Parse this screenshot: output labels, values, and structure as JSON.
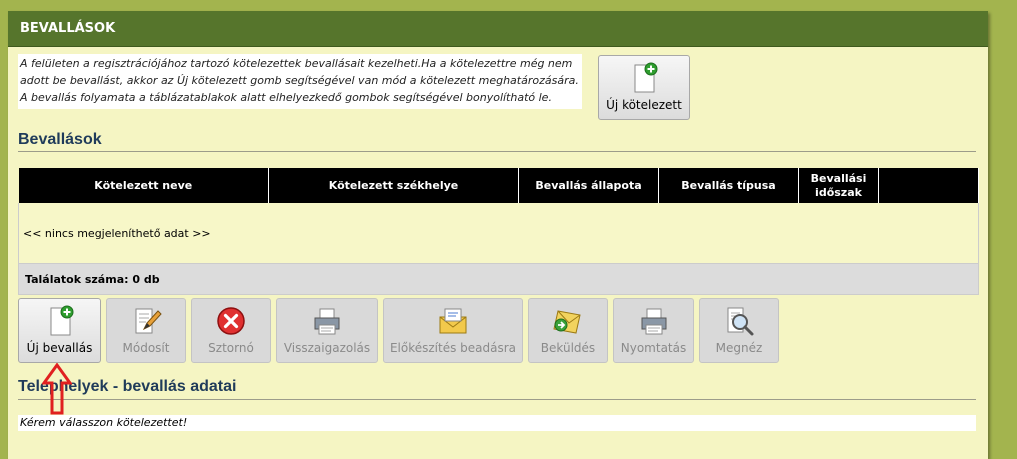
{
  "panel": {
    "title": "BEVALLÁSOK"
  },
  "intro_text": "A felületen a regisztrációjához tartozó kötelezettek bevallásait kezelheti.Ha a kötelezettre még nem adott be bevallást, akkor az Új kötelezett gomb segítségével van mód a kötelezett meghatározására. A bevallás folyamata a táblázatablakok alatt elhelyezkedő gombok segítségével bonyolítható le.",
  "new_obligor_button": {
    "label": "Új kötelezett",
    "icon": "new-document-plus-icon"
  },
  "declarations_section": {
    "title": "Bevallások"
  },
  "table": {
    "columns": [
      "Kötelezett neve",
      "Kötelezett székhelye",
      "Bevallás állapota",
      "Bevallás típusa",
      "Bevallási időszak",
      ""
    ],
    "empty_text": "<< nincs megjeleníthető adat >>",
    "result_count": "Találatok száma: 0 db"
  },
  "toolbar": [
    {
      "label": "Új bevallás",
      "icon": "new-document-plus-icon",
      "enabled": true
    },
    {
      "label": "Módosít",
      "icon": "edit-pencil-icon",
      "enabled": false
    },
    {
      "label": "Sztornó",
      "icon": "cancel-x-icon",
      "enabled": false
    },
    {
      "label": "Visszaigazolás",
      "icon": "printer-icon",
      "enabled": false
    },
    {
      "label": "Előkészítés beadásra",
      "icon": "envelope-icon",
      "enabled": false
    },
    {
      "label": "Beküldés",
      "icon": "send-envelope-icon",
      "enabled": false
    },
    {
      "label": "Nyomtatás",
      "icon": "printer-icon",
      "enabled": false
    },
    {
      "label": "Megnéz",
      "icon": "magnifier-icon",
      "enabled": false
    }
  ],
  "sites_section": {
    "title": "Telephelyek - bevallás adatai",
    "message": "Kérem válasszon kötelezettet!"
  },
  "colors": {
    "header_green": "#56752c",
    "panel_bg": "#f5f5c3",
    "outer_bg": "#a3b44e",
    "title_blue": "#1f3b5a",
    "arrow_red": "#e02020"
  }
}
